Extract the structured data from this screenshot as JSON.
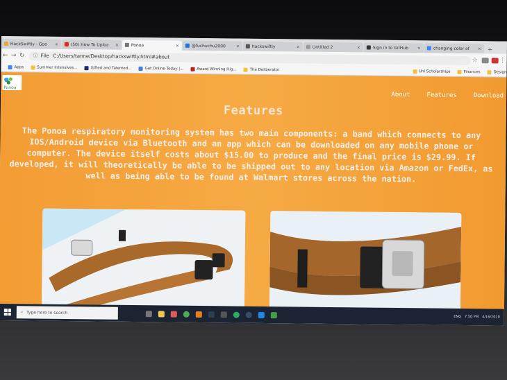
{
  "browser": {
    "tabs": [
      {
        "label": "HackSwiftly - Goo",
        "icon_color": "#e8a53a",
        "active": false
      },
      {
        "label": "(50) How To Uploa",
        "icon_color": "#e62117",
        "active": false
      },
      {
        "label": "Ponoa",
        "icon_color": "#777777",
        "active": true
      },
      {
        "label": "@fuchuchu2000",
        "icon_color": "#1a73e8",
        "active": false
      },
      {
        "label": "hackswiftly",
        "icon_color": "#555555",
        "active": false
      },
      {
        "label": "Untitled 2",
        "icon_color": "#999999",
        "active": false
      },
      {
        "label": "Sign in to GitHub",
        "icon_color": "#333333",
        "active": false
      },
      {
        "label": "changing color of",
        "icon_color": "#4285f4",
        "active": false
      }
    ],
    "tab_close": "×",
    "new_tab": "+",
    "url_info": "File",
    "url": "C:/Users/tanne/Desktop/hackswiftly.html#about",
    "bookmarks": [
      {
        "label": "Apps",
        "color": "#4285f4"
      },
      {
        "label": "Summer Intensives...",
        "color": "#f0c040"
      },
      {
        "label": "Gifted and Talented...",
        "color": "#1a2a6c"
      },
      {
        "label": "Get Online Today |...",
        "color": "#3c7dd9"
      },
      {
        "label": "Award Winning Hig...",
        "color": "#c02020"
      },
      {
        "label": "The Deliberator",
        "color": "#f0c040"
      },
      {
        "label": "Uni Scholarships",
        "color": "#f0c040"
      },
      {
        "label": "Finances",
        "color": "#f0c040"
      },
      {
        "label": "Design",
        "color": "#f0c040"
      }
    ]
  },
  "site": {
    "logo_text": "Ponoa",
    "nav": [
      "About",
      "Features",
      "Download"
    ],
    "title": "Features",
    "paragraph": "The Ponoa respiratory monitoring system has two main components: a band which connects to any IOS/Android device via Bluetooth and an app which can be downloaded on any mobile phone or computer. The device itself costs about $15.00 to produce and the final price is $29.99. If developed, it will theoretically be able to be shipped out to any location via Amazon or FedEx, as well as being able to be found at Walmart stores across the nation.",
    "accent": "#f4a13a"
  },
  "taskbar": {
    "search_placeholder": "Type here to search",
    "tray": [
      "ENG",
      "7:50 PM",
      "4/16/2020"
    ]
  }
}
